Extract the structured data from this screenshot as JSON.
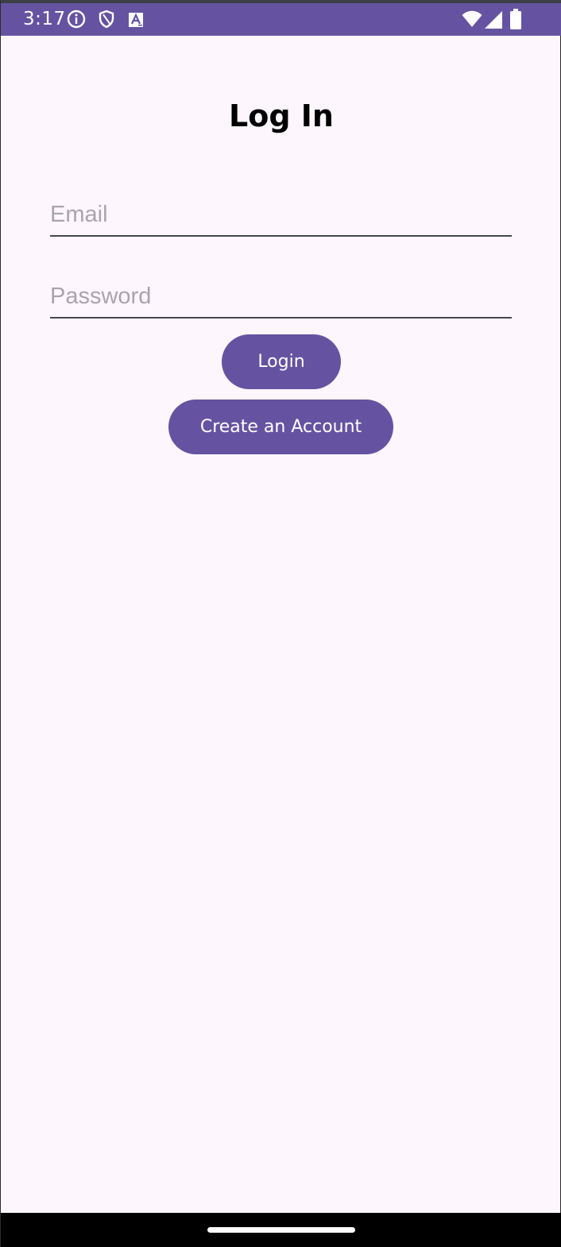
{
  "status_bar": {
    "time": "3:17",
    "left_icons": [
      "info-icon",
      "shield-icon",
      "text-a-icon"
    ],
    "right_icons": [
      "wifi-icon",
      "cell-signal-icon",
      "battery-icon"
    ],
    "color": "#6553a1"
  },
  "page": {
    "title": "Log In"
  },
  "form": {
    "email_placeholder": "Email",
    "email_value": "",
    "password_placeholder": "Password",
    "password_value": ""
  },
  "buttons": {
    "login_label": "Login",
    "create_account_label": "Create an Account"
  },
  "colors": {
    "accent": "#6553a1",
    "background": "#fdf7fd",
    "placeholder": "#a9a3ae",
    "underline": "#49454f"
  }
}
